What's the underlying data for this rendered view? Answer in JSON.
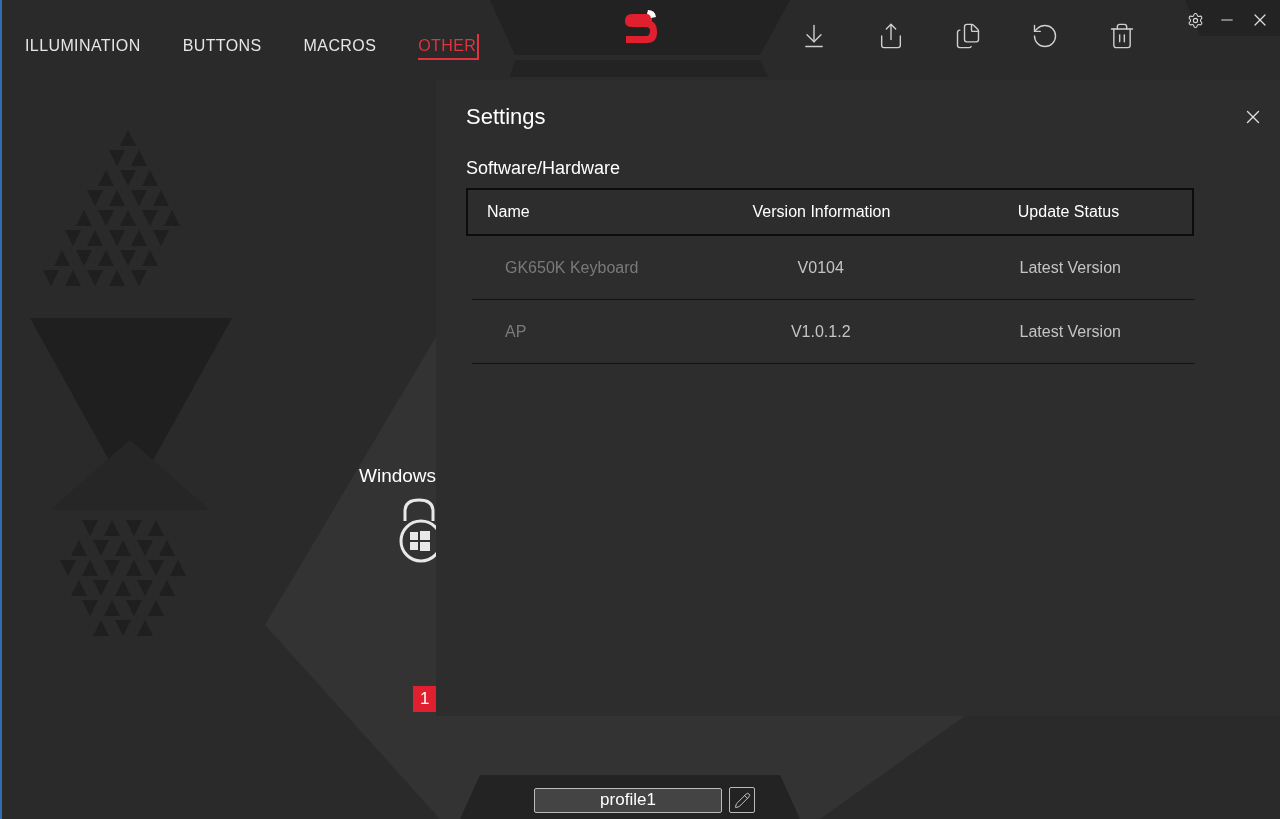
{
  "tabs": [
    {
      "label": "ILLUMINATION",
      "selected": false
    },
    {
      "label": "BUTTONS",
      "selected": false
    },
    {
      "label": "MACROS",
      "selected": false
    },
    {
      "label": "OTHER",
      "selected": true
    }
  ],
  "feature": {
    "label": "Windows",
    "badge": "1"
  },
  "profile": {
    "name": "profile1"
  },
  "dialog": {
    "title": "Settings",
    "section": "Software/Hardware",
    "columns": [
      "Name",
      "Version Information",
      "Update Status"
    ],
    "rows": [
      [
        "GK650K Keyboard",
        "V0104",
        "Latest Version"
      ],
      [
        "AP",
        "V1.0.1.2",
        "Latest Version"
      ]
    ]
  }
}
